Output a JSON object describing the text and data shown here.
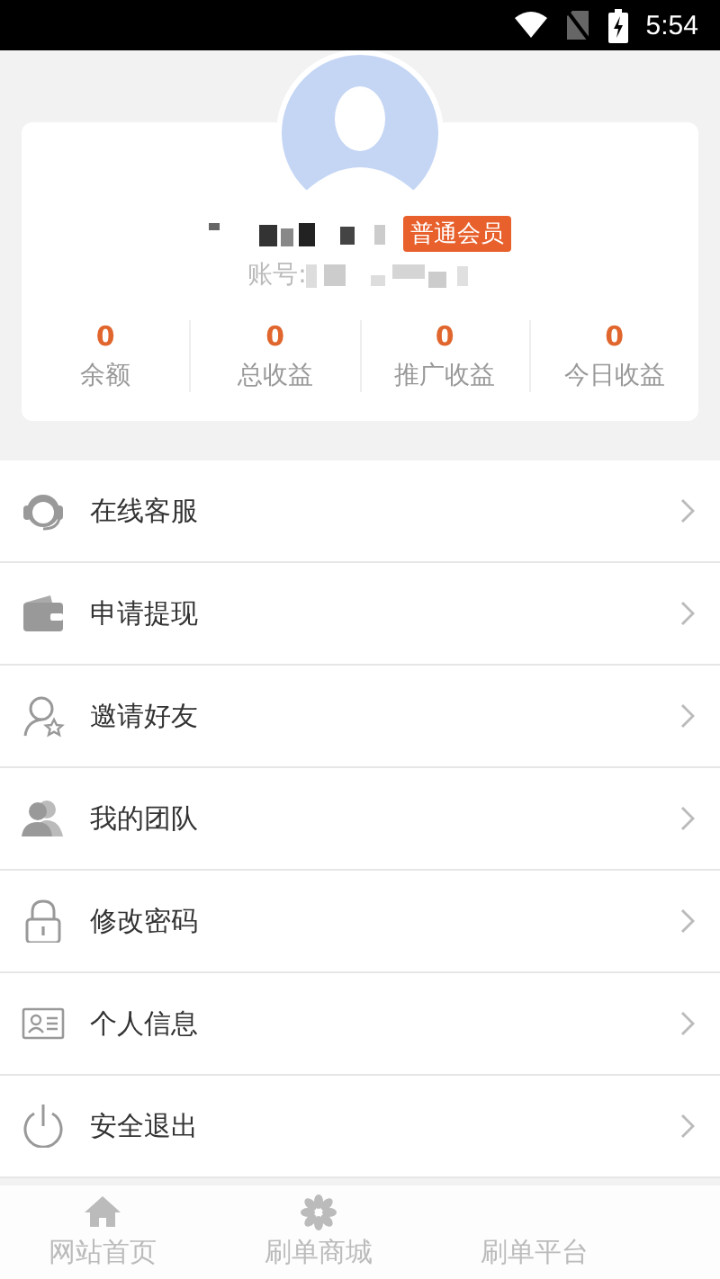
{
  "status_bar": {
    "time": "5:54"
  },
  "profile": {
    "badge": "普通会员",
    "account_label": "账号:"
  },
  "stats": [
    {
      "value": "0",
      "label": "余额"
    },
    {
      "value": "0",
      "label": "总收益"
    },
    {
      "value": "0",
      "label": "推广收益"
    },
    {
      "value": "0",
      "label": "今日收益"
    }
  ],
  "menu": [
    {
      "label": "在线客服"
    },
    {
      "label": "申请提现"
    },
    {
      "label": "邀请好友"
    },
    {
      "label": "我的团队"
    },
    {
      "label": "修改密码"
    },
    {
      "label": "个人信息"
    },
    {
      "label": "安全退出"
    }
  ],
  "bottom_nav": [
    {
      "label": "网站首页"
    },
    {
      "label": "刷单商城"
    },
    {
      "label": "刷单平台"
    }
  ]
}
